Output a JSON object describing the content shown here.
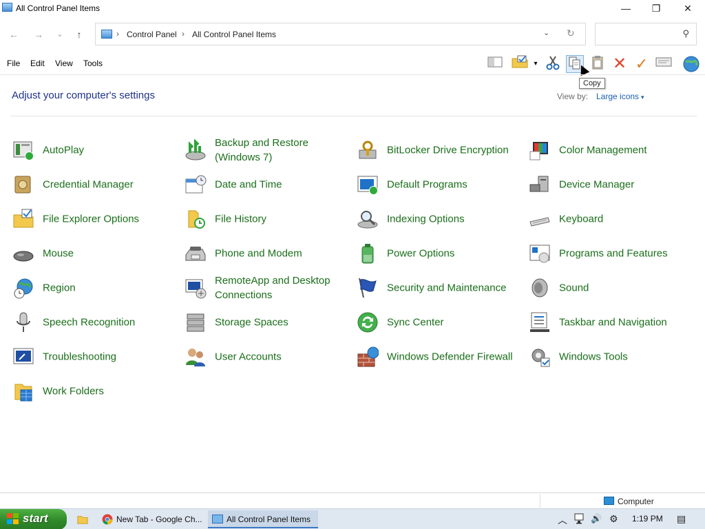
{
  "window": {
    "title": "All Control Panel Items",
    "min_glyph": "—",
    "max_glyph": "❐",
    "close_glyph": "✕"
  },
  "nav": {
    "back_glyph": "←",
    "forward_glyph": "→",
    "recent_glyph": "⌄",
    "up_glyph": "↑",
    "breadcrumb": [
      "Control Panel",
      "All Control Panel Items"
    ],
    "crumb_sep": "›",
    "dropdown_glyph": "⌄",
    "refresh_glyph": "↻",
    "search_placeholder": "",
    "search_glyph": "⚲"
  },
  "menu": [
    "File",
    "Edit",
    "View",
    "Tools"
  ],
  "toolbar": {
    "tooltip": "Copy"
  },
  "header": {
    "heading": "Adjust your computer's settings",
    "view_by_label": "View by:",
    "view_by_value": "Large icons",
    "view_by_arrow": "▾"
  },
  "items": [
    {
      "label": "AutoPlay",
      "icon": "autoplay-icon"
    },
    {
      "label": "Backup and Restore (Windows 7)",
      "icon": "backup-icon"
    },
    {
      "label": "BitLocker Drive Encryption",
      "icon": "bitlocker-icon"
    },
    {
      "label": "Color Management",
      "icon": "color-management-icon"
    },
    {
      "label": "Credential Manager",
      "icon": "credential-icon"
    },
    {
      "label": "Date and Time",
      "icon": "calendar-icon"
    },
    {
      "label": "Default Programs",
      "icon": "default-programs-icon"
    },
    {
      "label": "Device Manager",
      "icon": "device-manager-icon"
    },
    {
      "label": "File Explorer Options",
      "icon": "folder-options-icon"
    },
    {
      "label": "File History",
      "icon": "file-history-icon"
    },
    {
      "label": "Indexing Options",
      "icon": "indexing-icon"
    },
    {
      "label": "Keyboard",
      "icon": "keyboard-icon"
    },
    {
      "label": "Mouse",
      "icon": "mouse-icon"
    },
    {
      "label": "Phone and Modem",
      "icon": "phone-icon"
    },
    {
      "label": "Power Options",
      "icon": "power-icon"
    },
    {
      "label": "Programs and Features",
      "icon": "programs-icon"
    },
    {
      "label": "Region",
      "icon": "region-icon"
    },
    {
      "label": "RemoteApp and Desktop Connections",
      "icon": "remoteapp-icon"
    },
    {
      "label": "Security and Maintenance",
      "icon": "security-flag-icon"
    },
    {
      "label": "Sound",
      "icon": "speaker-icon"
    },
    {
      "label": "Speech Recognition",
      "icon": "microphone-icon"
    },
    {
      "label": "Storage Spaces",
      "icon": "storage-icon"
    },
    {
      "label": "Sync Center",
      "icon": "sync-icon"
    },
    {
      "label": "Taskbar and Navigation",
      "icon": "taskbar-icon"
    },
    {
      "label": "Troubleshooting",
      "icon": "troubleshooting-icon"
    },
    {
      "label": "User Accounts",
      "icon": "users-icon"
    },
    {
      "label": "Windows Defender Firewall",
      "icon": "firewall-icon"
    },
    {
      "label": "Windows Tools",
      "icon": "gear-tools-icon"
    },
    {
      "label": "Work Folders",
      "icon": "work-folders-icon"
    }
  ],
  "status": {
    "computer": "Computer"
  },
  "taskbar": {
    "start_label": "start",
    "tasks": [
      "New Tab - Google Ch...",
      "All Control Panel Items"
    ],
    "tray_up": "︿",
    "tray_volume": "🔊",
    "tray_gear": "⚙",
    "time": "1:19 PM",
    "notification_glyph": "▤"
  },
  "colors": {
    "link_green": "#1a6e1a",
    "heading_blue": "#1e3287",
    "start_green": "#3a9a33"
  }
}
